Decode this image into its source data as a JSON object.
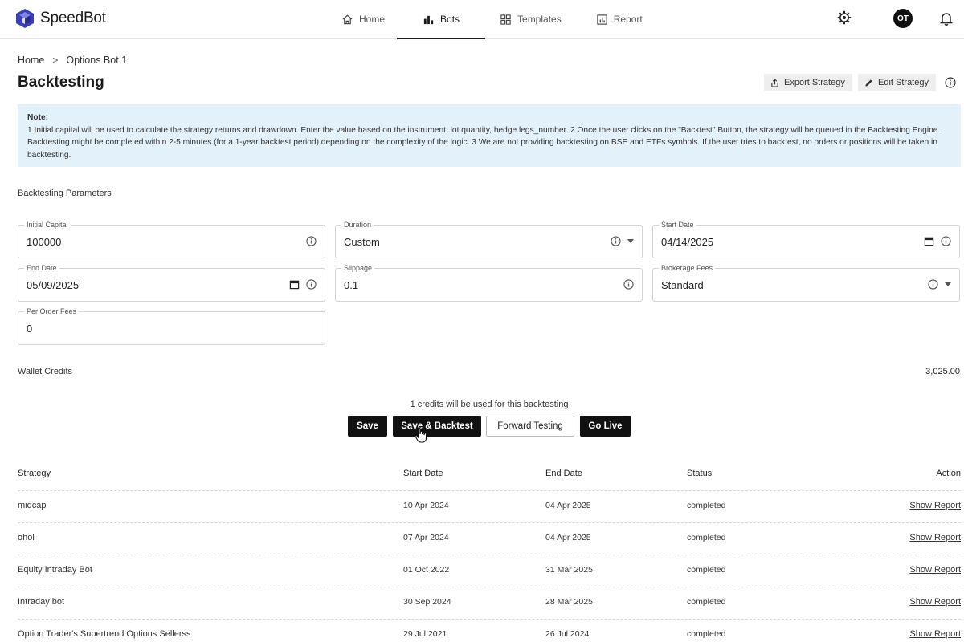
{
  "app": {
    "name": "SpeedBot"
  },
  "nav": {
    "tabs": [
      {
        "label": "Home",
        "icon": "home-icon"
      },
      {
        "label": "Bots",
        "icon": "bar-chart-icon",
        "active": true
      },
      {
        "label": "Templates",
        "icon": "grid-icon"
      },
      {
        "label": "Report",
        "icon": "report-icon"
      }
    ],
    "avatar_initials": "OT"
  },
  "breadcrumb": {
    "items": [
      "Home",
      "Options Bot 1"
    ],
    "separator": ">"
  },
  "page": {
    "title": "Backtesting",
    "export_label": "Export Strategy",
    "edit_label": "Edit Strategy"
  },
  "note": {
    "title": "Note:",
    "text": "1 Initial capital will be used to calculate the strategy returns and drawdown. Enter the value based on the instrument, lot quantity, hedge legs_number. 2 Once the user clicks on the \"Backtest\" Button, the strategy will be queued in the Backtesting Engine. Backtesting might be completed within 2-5 minutes (for a 1-year backtest period) depending on the complexity of the logic. 3 We are not providing backtesting on BSE and ETFs symbols. If the user tries to backtest, no orders or positions will be taken in backtesting."
  },
  "params": {
    "section_label": "Backtesting Parameters",
    "initial_capital": {
      "label": "Initial Capital",
      "value": "100000"
    },
    "duration": {
      "label": "Duration",
      "value": "Custom"
    },
    "start_date": {
      "label": "Start Date",
      "value": "04/14/2025"
    },
    "end_date": {
      "label": "End Date",
      "value": "05/09/2025"
    },
    "slippage": {
      "label": "Slippage",
      "value": "0.1"
    },
    "brokerage_fees": {
      "label": "Brokerage Fees",
      "value": "Standard"
    },
    "per_order_fees": {
      "label": "Per Order Fees",
      "value": "0"
    }
  },
  "wallet": {
    "label": "Wallet Credits",
    "value": "3,025.00"
  },
  "actions": {
    "credits_note": "1 credits will be used for this backtesting",
    "save": "Save",
    "save_backtest": "Save & Backtest",
    "forward_testing": "Forward Testing",
    "go_live": "Go Live"
  },
  "table": {
    "headers": [
      "Strategy",
      "Start Date",
      "End Date",
      "Status",
      "Action"
    ],
    "rows": [
      {
        "strategy": "midcap",
        "start": "10 Apr 2024",
        "end": "04 Apr 2025",
        "status": "completed",
        "action": "Show Report"
      },
      {
        "strategy": "ohol",
        "start": "07 Apr 2024",
        "end": "04 Apr 2025",
        "status": "completed",
        "action": "Show Report"
      },
      {
        "strategy": "Equity Intraday Bot",
        "start": "01 Oct 2022",
        "end": "31 Mar 2025",
        "status": "completed",
        "action": "Show Report"
      },
      {
        "strategy": "Intraday bot",
        "start": "30 Sep 2024",
        "end": "28 Mar 2025",
        "status": "completed",
        "action": "Show Report"
      },
      {
        "strategy": "Option Trader's Supertrend Options Sellerss",
        "start": "29 Jul 2021",
        "end": "26 Jul 2024",
        "status": "completed",
        "action": "Show Report"
      }
    ]
  },
  "colors": {
    "brand": "#3b3fb6",
    "note_bg": "#e3f1fb",
    "dark_button": "#111111"
  }
}
